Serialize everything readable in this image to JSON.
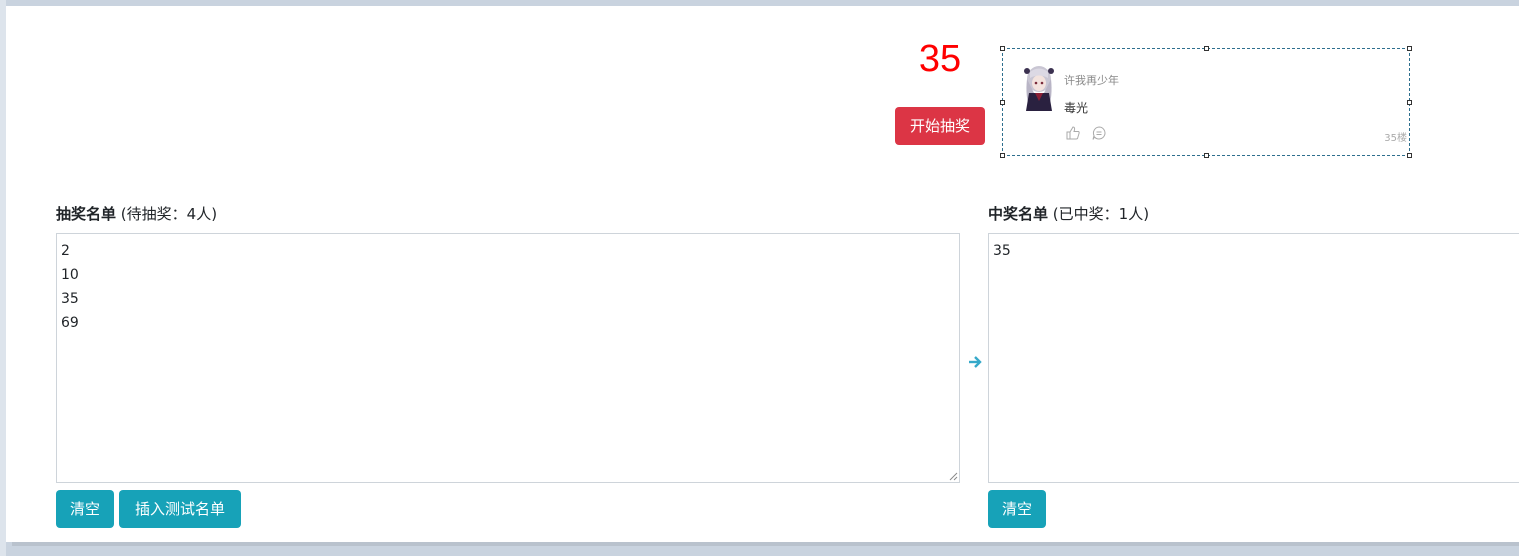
{
  "draw": {
    "current_number": "35",
    "start_label": "开始抽奖"
  },
  "comment_card": {
    "username": "许我再少年",
    "text": "毒光",
    "floor": "35楼",
    "icons": [
      "avatar-image",
      "like-icon",
      "reply-icon"
    ]
  },
  "pool": {
    "title": "抽奖名单",
    "subtitle": "(待抽奖：4人)",
    "names": [
      "2",
      "10",
      "35",
      "69"
    ],
    "clear_label": "清空",
    "insert_label": "插入测试名单"
  },
  "winners": {
    "title": "中奖名单",
    "subtitle": "(已中奖：1人)",
    "names": [
      "35"
    ],
    "clear_label": "清空"
  },
  "colors": {
    "number": "#ff0000",
    "danger": "#dc3545",
    "info": "#17a2b8",
    "arrow": "#36a9c9"
  }
}
